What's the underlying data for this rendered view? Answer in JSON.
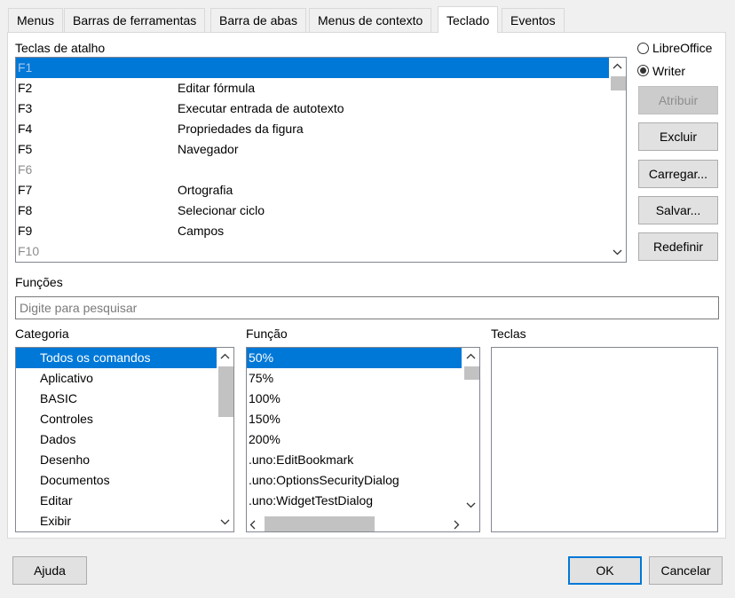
{
  "tabs": [
    {
      "label": "Menus"
    },
    {
      "label": "Barras de ferramentas"
    },
    {
      "label": "Barra de abas"
    },
    {
      "label": "Menus de contexto"
    },
    {
      "label": "Teclado"
    },
    {
      "label": "Eventos"
    }
  ],
  "shortcuts": {
    "label": "Teclas de atalho",
    "rows": [
      {
        "key": "F1",
        "cmd": "",
        "selected": true,
        "disabled": true
      },
      {
        "key": "F2",
        "cmd": "Editar fórmula"
      },
      {
        "key": "F3",
        "cmd": "Executar entrada de autotexto"
      },
      {
        "key": "F4",
        "cmd": "Propriedades da figura"
      },
      {
        "key": "F5",
        "cmd": "Navegador"
      },
      {
        "key": "F6",
        "cmd": "",
        "disabled": true
      },
      {
        "key": "F7",
        "cmd": "Ortografia"
      },
      {
        "key": "F8",
        "cmd": "Selecionar ciclo"
      },
      {
        "key": "F9",
        "cmd": "Campos"
      },
      {
        "key": "F10",
        "cmd": "",
        "disabled": true
      }
    ]
  },
  "scope": {
    "libreoffice": "LibreOffice",
    "writer": "Writer",
    "selected": "Writer"
  },
  "buttons": {
    "atribuir": "Atribuir",
    "excluir": "Excluir",
    "carregar": "Carregar...",
    "salvar": "Salvar...",
    "redefinir": "Redefinir"
  },
  "functions": {
    "label": "Funções",
    "search_placeholder": "Digite para pesquisar"
  },
  "categoria": {
    "label": "Categoria",
    "items": [
      "Todos os comandos",
      "Aplicativo",
      "BASIC",
      "Controles",
      "Dados",
      "Desenho",
      "Documentos",
      "Editar",
      "Exibir"
    ],
    "selected_index": 0
  },
  "funcao": {
    "label": "Função",
    "items": [
      "50%",
      "75%",
      "100%",
      "150%",
      "200%",
      ".uno:EditBookmark",
      ".uno:OptionsSecurityDialog",
      ".uno:WidgetTestDialog"
    ],
    "selected_index": 0
  },
  "teclas": {
    "label": "Teclas"
  },
  "footer": {
    "ajuda": "Ajuda",
    "ok": "OK",
    "cancelar": "Cancelar"
  },
  "icons": {
    "scroll_up": "chevron-up-icon",
    "scroll_down": "chevron-down-icon",
    "scroll_left": "chevron-left-icon",
    "scroll_right": "chevron-right-icon"
  },
  "colors": {
    "selection": "#0078d7",
    "default_button_border": "#0078d7"
  }
}
